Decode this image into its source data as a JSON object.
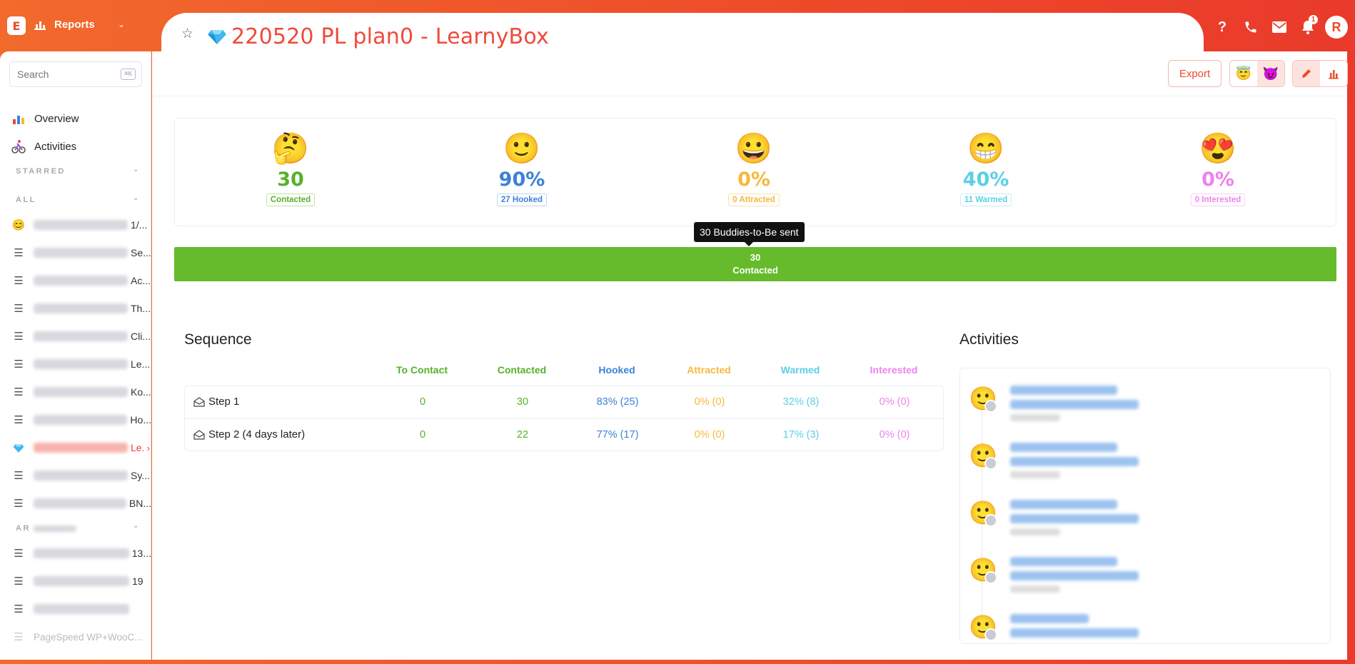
{
  "topbar": {
    "logo_letter": "E",
    "module_label": "Reports",
    "page_title": "220520 PL plan0 - LearnyBox",
    "notification_count": "1",
    "avatar_initial": "R",
    "icons": [
      "help-icon",
      "phone-icon",
      "mail-icon",
      "bell-icon"
    ]
  },
  "sidebar": {
    "search_placeholder": "Search",
    "search_shortcut": "⌘K",
    "nav": [
      {
        "label": "Overview",
        "icon": "chart-icon"
      },
      {
        "label": "Activities",
        "icon": "cyclist-icon"
      }
    ],
    "sections": {
      "starred": "STARRED",
      "all": "ALL",
      "archived": "AR"
    },
    "items": [
      {
        "suffix": "1/...",
        "icon": "smile-emoji"
      },
      {
        "suffix": "Se...",
        "icon": "list-icon"
      },
      {
        "suffix": "Ac...",
        "icon": "list-icon"
      },
      {
        "suffix": "Th...",
        "icon": "list-icon"
      },
      {
        "suffix": "Cli...",
        "icon": "list-icon"
      },
      {
        "suffix": "Le...",
        "icon": "list-icon"
      },
      {
        "suffix": "Ko...",
        "icon": "list-icon"
      },
      {
        "suffix": "Ho...",
        "icon": "list-icon"
      },
      {
        "suffix": "Le.",
        "icon": "gem-icon",
        "active": true
      },
      {
        "suffix": "Sy...",
        "icon": "list-icon"
      },
      {
        "suffix": "BN...",
        "icon": "list-icon"
      }
    ],
    "archived_items": [
      {
        "suffix": "13...",
        "icon": "list-icon"
      },
      {
        "suffix": "19",
        "icon": "list-icon"
      },
      {
        "suffix": "",
        "icon": "list-icon"
      },
      {
        "suffix": "PageSpeed WP+WooC...",
        "icon": "list-icon"
      }
    ]
  },
  "toolbar": {
    "export_label": "Export",
    "mode_a": "angel-emoji",
    "mode_b": "devil-emoji",
    "view_edit": "pencil-icon",
    "view_chart": "bar-chart-icon"
  },
  "stats": [
    {
      "emoji": "🤔",
      "value": "30",
      "label": "Contacted",
      "color": "#58b02a"
    },
    {
      "emoji": "🙂",
      "value": "90%",
      "label": "27 Hooked",
      "color": "#3b82d6"
    },
    {
      "emoji": "😀",
      "value": "0%",
      "label": "0 Attracted",
      "color": "#f6b93b"
    },
    {
      "emoji": "😁",
      "value": "40%",
      "label": "11 Warmed",
      "color": "#5ccfe6"
    },
    {
      "emoji": "😍",
      "value": "0%",
      "label": "0 Interested",
      "color": "#ee82ee"
    }
  ],
  "tooltip": "30 Buddies-to-Be sent",
  "progress": {
    "value": "30",
    "label": "Contacted",
    "fill_fraction": 1.0,
    "color": "#66bb2c"
  },
  "sequence": {
    "title": "Sequence",
    "columns": [
      {
        "label": "To Contact",
        "color": "#58b02a"
      },
      {
        "label": "Contacted",
        "color": "#58b02a"
      },
      {
        "label": "Hooked",
        "color": "#3b82d6"
      },
      {
        "label": "Attracted",
        "color": "#f6b93b"
      },
      {
        "label": "Warmed",
        "color": "#5ccfe6"
      },
      {
        "label": "Interested",
        "color": "#ee82ee"
      }
    ],
    "rows": [
      {
        "name": "Step 1",
        "cells": [
          "0",
          "30",
          "83% (25)",
          "0% (0)",
          "32% (8)",
          "0% (0)"
        ]
      },
      {
        "name": "Step 2 (4 days later)",
        "cells": [
          "0",
          "22",
          "77% (17)",
          "0% (0)",
          "17% (3)",
          "0% (0)"
        ]
      }
    ]
  },
  "activities": {
    "title": "Activities",
    "items": [
      {
        "emoji": "🙂"
      },
      {
        "emoji": "🙂"
      },
      {
        "emoji": "🙂"
      },
      {
        "emoji": "🙂"
      },
      {
        "emoji": "🙂"
      }
    ]
  }
}
